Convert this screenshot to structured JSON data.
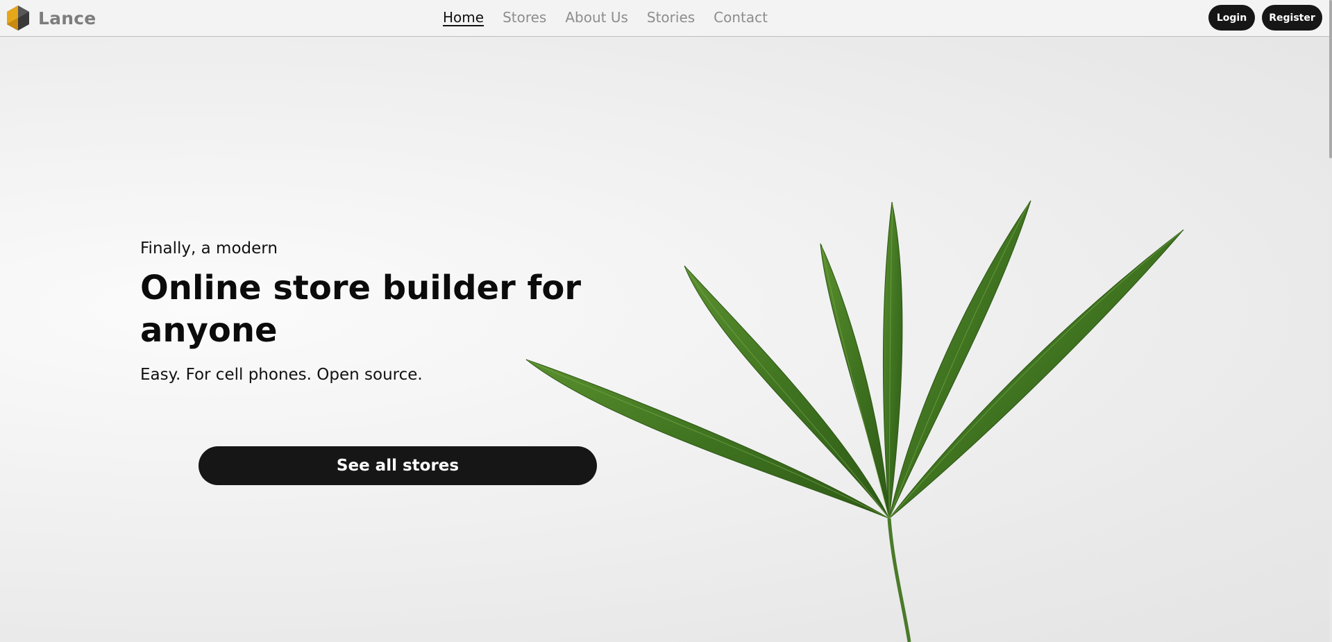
{
  "brand": {
    "name": "Lance",
    "logo_icon": "hexagon-cube-logo",
    "logo_colors": [
      "#e5a61a",
      "#3a3a3a"
    ]
  },
  "nav": {
    "items": [
      {
        "label": "Home",
        "active": true
      },
      {
        "label": "Stores",
        "active": false
      },
      {
        "label": "About Us",
        "active": false
      },
      {
        "label": "Stories",
        "active": false
      },
      {
        "label": "Contact",
        "active": false
      }
    ]
  },
  "auth": {
    "login_label": "Login",
    "register_label": "Register"
  },
  "hero": {
    "kicker": "Finally, a modern",
    "headline": "Online store builder for anyone",
    "subheadline": "Easy. For cell phones. Open source.",
    "cta_label": "See all stores",
    "image": "palm-leaf-photo"
  },
  "colors": {
    "button_bg": "#161616",
    "accent": "#e5a61a",
    "leaf_green": "#3f7320"
  }
}
